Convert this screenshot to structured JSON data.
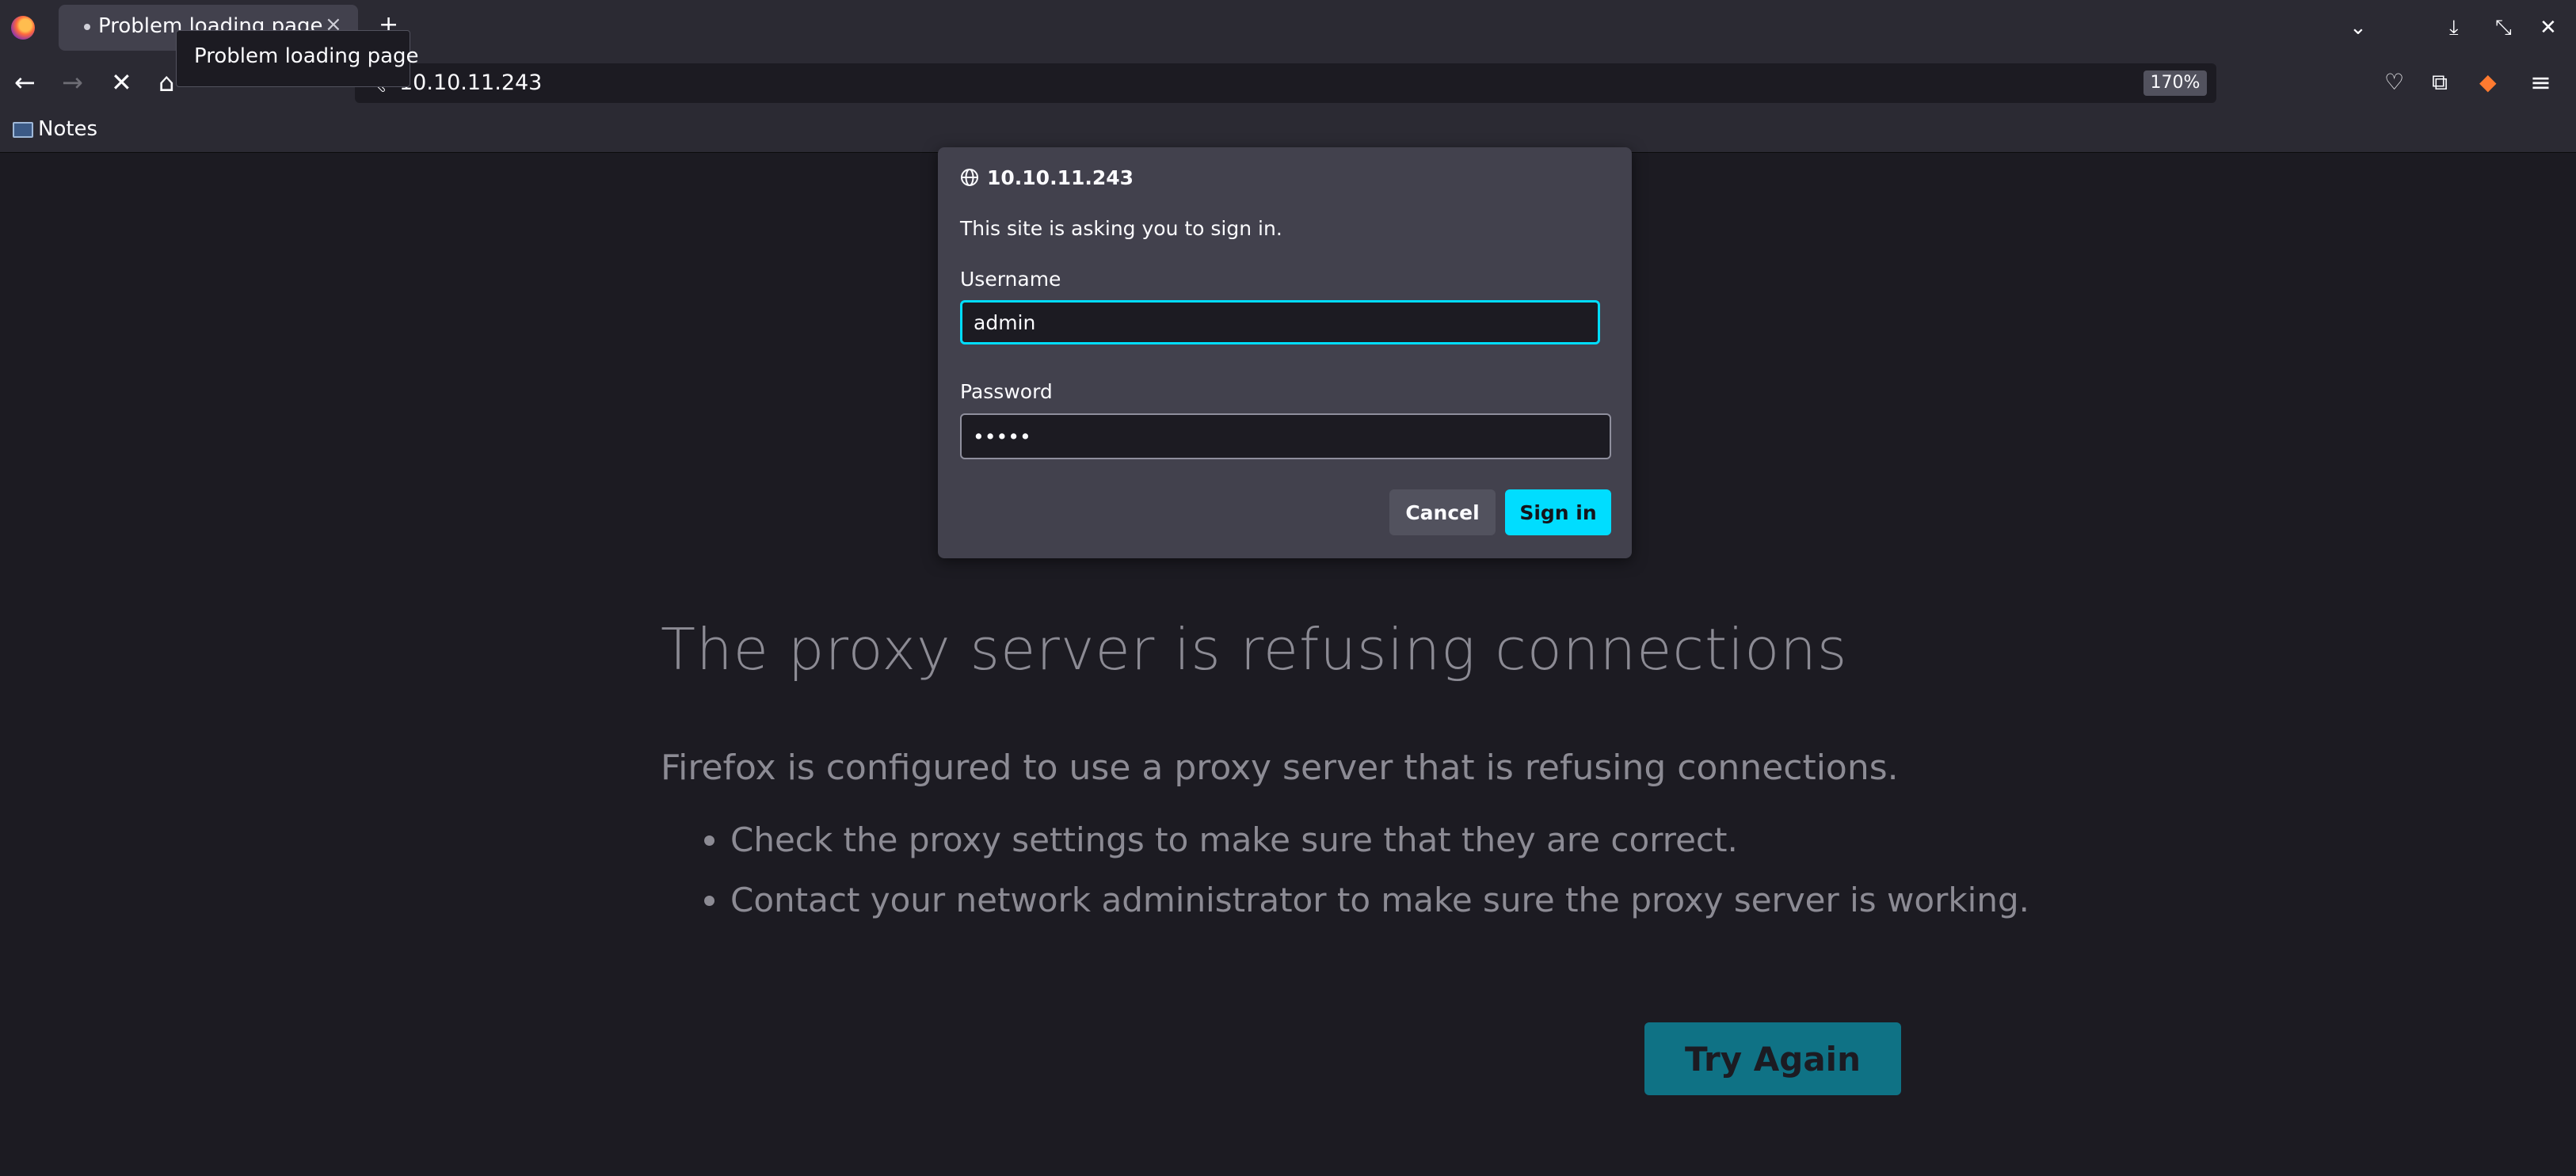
{
  "browser": {
    "tab_title": "Problem loading page",
    "tab_close": "×",
    "new_tab": "+",
    "tooltip": "Problem loading page",
    "url": "10.10.11.243",
    "zoom": "170%",
    "icons": [
      "firefox-logo-icon",
      "back-arrow-icon",
      "forward-arrow-icon",
      "stop-icon",
      "home-icon",
      "search-icon",
      "pocket-icon",
      "extensions-icon",
      "fox-extension-icon",
      "hamburger-menu-icon",
      "list-tabs-icon",
      "minimize-icon",
      "restore-icon",
      "close-window-icon"
    ]
  },
  "bookmarks": {
    "items": [
      {
        "label": "Notes"
      }
    ]
  },
  "auth_dialog": {
    "host": "10.10.11.243",
    "message": "This site is asking you to sign in.",
    "username_label": "Username",
    "username_value": "admin",
    "password_label": "Password",
    "password_value": "•••••",
    "cancel_label": "Cancel",
    "signin_label": "Sign in",
    "accent_color": "#00ddff"
  },
  "error_page": {
    "title": "The proxy server is refusing connections",
    "description": "Firefox is configured to use a proxy server that is refusing connections.",
    "suggestions": [
      "Check the proxy settings to make sure that they are correct.",
      "Contact your network administrator to make sure the proxy server is working."
    ],
    "button_label": "Try Again"
  }
}
